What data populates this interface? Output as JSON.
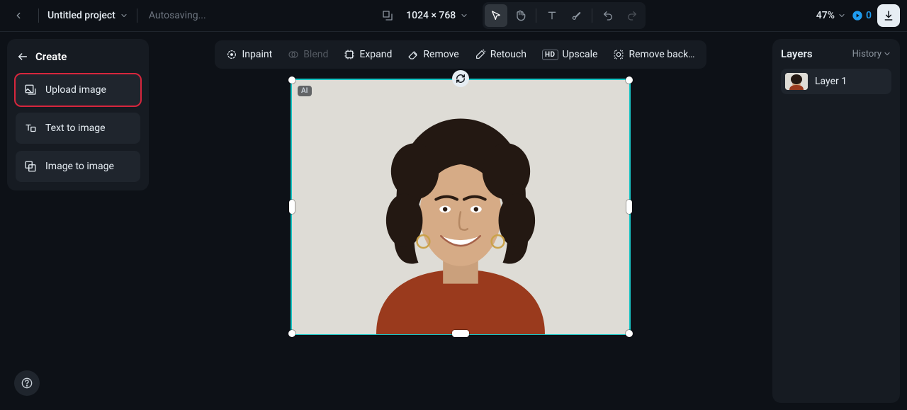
{
  "topbar": {
    "project_name": "Untitled project",
    "autosave": "Autosaving...",
    "dimensions": "1024 × 768",
    "zoom": "47%",
    "credits": "0"
  },
  "sidebar": {
    "title": "Create",
    "items": [
      {
        "label": "Upload image"
      },
      {
        "label": "Text to image"
      },
      {
        "label": "Image to image"
      }
    ]
  },
  "toolbar": {
    "inpaint": "Inpaint",
    "blend": "Blend",
    "expand": "Expand",
    "remove": "Remove",
    "retouch": "Retouch",
    "upscale": "Upscale",
    "upscale_badge": "HD",
    "remove_bg": "Remove back…"
  },
  "canvas": {
    "ai_badge": "AI"
  },
  "layers": {
    "title": "Layers",
    "history": "History",
    "items": [
      {
        "label": "Layer 1"
      }
    ]
  }
}
